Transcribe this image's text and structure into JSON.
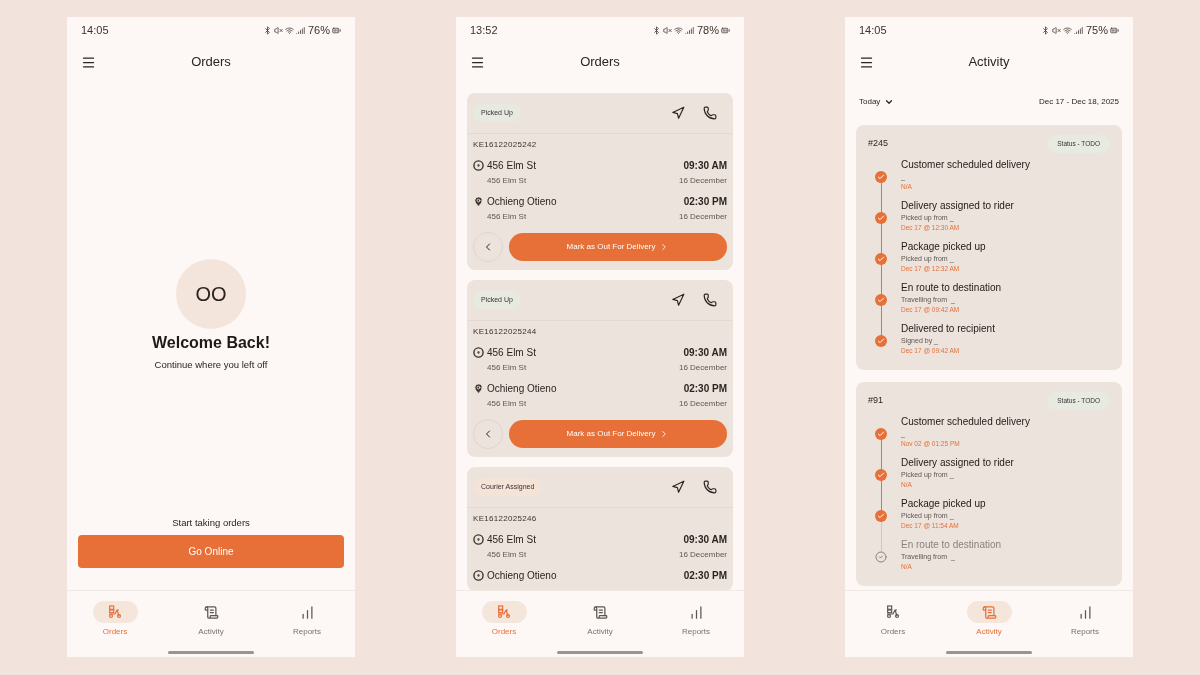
{
  "screens": [
    {
      "kind": "welcome",
      "status_bar": {
        "time": "14:05",
        "battery": "76%"
      },
      "title": "Orders",
      "avatar": "OO",
      "heading": "Welcome Back!",
      "subheading": "Continue where you left off",
      "prompt": "Start taking orders",
      "primary_button": "Go Online",
      "nav": [
        {
          "kind": "orders",
          "label": "Orders",
          "selected": true
        },
        {
          "kind": "activity",
          "label": "Activity",
          "selected": false
        },
        {
          "kind": "reports",
          "label": "Reports",
          "selected": false
        }
      ]
    },
    {
      "kind": "orders",
      "status_bar": {
        "time": "13:52",
        "battery": "78%"
      },
      "title": "Orders",
      "orders": [
        {
          "status": "Picked Up",
          "color": "#e6eae1",
          "id": "KE16122025242",
          "stops": [
            {
              "kind": "pickup",
              "name": "456 Elm St",
              "address": "456 Elm St",
              "time": "09:30 AM",
              "date": "16 December"
            },
            {
              "kind": "dropoff",
              "name": "Ochieng Otieno",
              "address": "456 Elm St",
              "time": "02:30 PM",
              "date": "16 December"
            }
          ],
          "action": "Mark as Out For Delivery"
        },
        {
          "status": "Picked Up",
          "color": "#e6eae1",
          "id": "KE16122025244",
          "stops": [
            {
              "kind": "pickup",
              "name": "456 Elm St",
              "address": "456 Elm St",
              "time": "09:30 AM",
              "date": "16 December"
            },
            {
              "kind": "dropoff",
              "name": "Ochieng Otieno",
              "address": "456 Elm St",
              "time": "02:30 PM",
              "date": "16 December"
            }
          ],
          "action": "Mark as Out For Delivery"
        },
        {
          "status": "Courier Assigned",
          "color": "#f4e3d7",
          "id": "KE16122025246",
          "stops": [
            {
              "kind": "pickup",
              "name": "456 Elm St",
              "address": "456 Elm St",
              "time": "09:30 AM",
              "date": "16 December"
            },
            {
              "kind": "pickup",
              "name": "Ochieng Otieno",
              "time": "02:30 PM"
            }
          ]
        }
      ],
      "nav": [
        {
          "kind": "orders",
          "label": "Orders",
          "selected": true
        },
        {
          "kind": "activity",
          "label": "Activity",
          "selected": false
        },
        {
          "kind": "reports",
          "label": "Reports",
          "selected": false
        }
      ]
    },
    {
      "kind": "activity",
      "status_bar": {
        "time": "14:05",
        "battery": "75%"
      },
      "title": "Activity",
      "filter": "Today",
      "date_range": "Dec 17 - Dec 18, 2025",
      "deliveries": [
        {
          "number": "#245",
          "status": "Status - TODO",
          "steps": [
            {
              "title": "Customer scheduled delivery",
              "detail": "_",
              "time": "N/A",
              "done": true
            },
            {
              "title": "Delivery assigned to rider",
              "detail": "Picked up from _",
              "time": "Dec 17 @ 12:30 AM",
              "done": true
            },
            {
              "title": "Package picked up",
              "detail": "Picked up from _",
              "time": "Dec 17 @ 12:32 AM",
              "done": true
            },
            {
              "title": "En route to destination",
              "detail": "Travelling from  _",
              "time": "Dec 17 @ 09:42 AM",
              "done": true
            },
            {
              "title": "Delivered to recipient",
              "detail": "Signed by _",
              "time": "Dec 17 @ 09:42 AM",
              "done": true
            }
          ]
        },
        {
          "number": "#91",
          "status": "Status - TODO",
          "steps": [
            {
              "title": "Customer scheduled delivery",
              "detail": "_",
              "time": "Nov 02 @ 01:25 PM",
              "done": true
            },
            {
              "title": "Delivery assigned to rider",
              "detail": "Picked up from _",
              "time": "N/A",
              "done": true
            },
            {
              "title": "Package picked up",
              "detail": "Picked up from _",
              "time": "Dec 17 @ 11:54 AM",
              "done": true
            },
            {
              "title": "En route to destination",
              "detail": "Travelling from  _",
              "time": "N/A",
              "done": false
            }
          ]
        }
      ],
      "nav": [
        {
          "kind": "orders",
          "label": "Orders",
          "selected": false
        },
        {
          "kind": "activity",
          "label": "Activity",
          "selected": true
        },
        {
          "kind": "reports",
          "label": "Reports",
          "selected": false
        }
      ]
    }
  ]
}
